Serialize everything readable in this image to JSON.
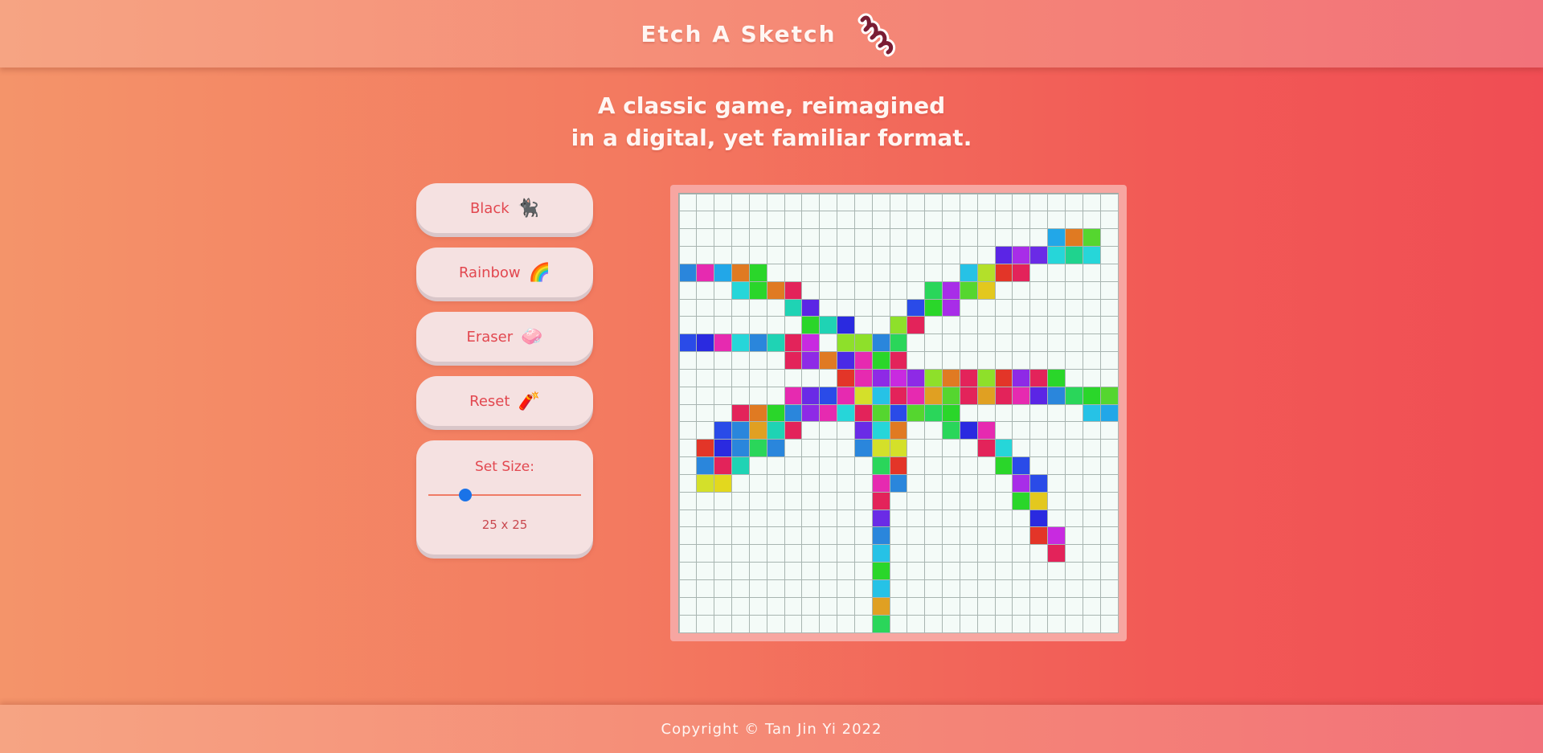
{
  "header": {
    "title": "Etch A Sketch",
    "logo_icon": "squiggle-logo-icon"
  },
  "tagline": {
    "line1": "A classic game, reimagined",
    "line2": "in a digital, yet familiar format."
  },
  "buttons": [
    {
      "label": "Black",
      "emoji": "🐈‍⬛",
      "icon": "black-cat-icon"
    },
    {
      "label": "Rainbow",
      "emoji": "🌈",
      "icon": "rainbow-icon"
    },
    {
      "label": "Eraser",
      "emoji": "🧼",
      "icon": "eraser-icon"
    },
    {
      "label": "Reset",
      "emoji": "🧨",
      "icon": "firecracker-icon"
    }
  ],
  "size": {
    "label": "Set Size:",
    "value_text": "25 x 25",
    "value": 25,
    "min": 1,
    "max": 100
  },
  "grid": {
    "size": 25,
    "empty_color": "#f4fbf8",
    "painted": [
      [
        2,
        21,
        "#22a7e8"
      ],
      [
        2,
        22,
        "#e07a22"
      ],
      [
        2,
        23,
        "#55d62f"
      ],
      [
        3,
        18,
        "#5b25e5"
      ],
      [
        3,
        19,
        "#a82de8"
      ],
      [
        3,
        20,
        "#6a2be6"
      ],
      [
        3,
        21,
        "#26d6d9"
      ],
      [
        3,
        22,
        "#1fd38e"
      ],
      [
        3,
        23,
        "#26d6d9"
      ],
      [
        4,
        0,
        "#2a86dc"
      ],
      [
        4,
        1,
        "#e62ab0"
      ],
      [
        4,
        2,
        "#22a7e8"
      ],
      [
        4,
        3,
        "#e07a22"
      ],
      [
        4,
        4,
        "#2ad62a"
      ],
      [
        4,
        16,
        "#26c2e6"
      ],
      [
        4,
        17,
        "#b3e02a"
      ],
      [
        4,
        18,
        "#e33528"
      ],
      [
        4,
        19,
        "#e3235a"
      ],
      [
        5,
        3,
        "#26d6d9"
      ],
      [
        5,
        4,
        "#2ad62a"
      ],
      [
        5,
        5,
        "#e07a22"
      ],
      [
        5,
        6,
        "#e3235a"
      ],
      [
        5,
        14,
        "#2ad65a"
      ],
      [
        5,
        15,
        "#a82de8"
      ],
      [
        5,
        16,
        "#55d62f"
      ],
      [
        5,
        17,
        "#e3c81e"
      ],
      [
        6,
        6,
        "#1fd3b4"
      ],
      [
        6,
        7,
        "#5b25e5"
      ],
      [
        6,
        13,
        "#2a4be8"
      ],
      [
        6,
        14,
        "#2ad62a"
      ],
      [
        6,
        15,
        "#a82de8"
      ],
      [
        7,
        7,
        "#2ad62a"
      ],
      [
        7,
        8,
        "#1fd3b4"
      ],
      [
        7,
        9,
        "#2a2ae0"
      ],
      [
        7,
        12,
        "#8ee02a"
      ],
      [
        7,
        13,
        "#e3235a"
      ],
      [
        8,
        0,
        "#2a4be8"
      ],
      [
        8,
        1,
        "#2a2ae0"
      ],
      [
        8,
        2,
        "#e62ab0"
      ],
      [
        8,
        3,
        "#26d6d9"
      ],
      [
        8,
        4,
        "#2a86dc"
      ],
      [
        8,
        5,
        "#1fd3b4"
      ],
      [
        8,
        6,
        "#e3235a"
      ],
      [
        8,
        7,
        "#c82ae0"
      ],
      [
        8,
        9,
        "#8ee02a"
      ],
      [
        8,
        10,
        "#8ee02a"
      ],
      [
        8,
        11,
        "#2a86dc"
      ],
      [
        8,
        12,
        "#2ad65a"
      ],
      [
        9,
        6,
        "#e3235a"
      ],
      [
        9,
        7,
        "#8e2ae6"
      ],
      [
        9,
        8,
        "#e07a22"
      ],
      [
        9,
        9,
        "#4a2ae6"
      ],
      [
        9,
        10,
        "#e62ab0"
      ],
      [
        9,
        11,
        "#2ad62a"
      ],
      [
        9,
        12,
        "#e3235a"
      ],
      [
        10,
        9,
        "#e33528"
      ],
      [
        10,
        10,
        "#e62ab0"
      ],
      [
        10,
        11,
        "#8e2ae6"
      ],
      [
        10,
        12,
        "#c82ae0"
      ],
      [
        10,
        13,
        "#8e2ae6"
      ],
      [
        10,
        14,
        "#8ee02a"
      ],
      [
        10,
        15,
        "#e07a22"
      ],
      [
        10,
        16,
        "#e3235a"
      ],
      [
        10,
        17,
        "#8ee02a"
      ],
      [
        10,
        18,
        "#e33528"
      ],
      [
        10,
        19,
        "#8e2ae6"
      ],
      [
        10,
        20,
        "#e3235a"
      ],
      [
        10,
        21,
        "#2ad62a"
      ],
      [
        11,
        6,
        "#e62ab0"
      ],
      [
        11,
        7,
        "#6a2be6"
      ],
      [
        11,
        8,
        "#2a4be8"
      ],
      [
        11,
        9,
        "#e62ab0"
      ],
      [
        11,
        10,
        "#d4e02a"
      ],
      [
        11,
        11,
        "#26c2e6"
      ],
      [
        11,
        12,
        "#e3235a"
      ],
      [
        11,
        13,
        "#e62ab0"
      ],
      [
        11,
        14,
        "#e0a022"
      ],
      [
        11,
        15,
        "#55d62f"
      ],
      [
        11,
        16,
        "#e3235a"
      ],
      [
        11,
        17,
        "#e0a022"
      ],
      [
        11,
        18,
        "#e3235a"
      ],
      [
        11,
        19,
        "#e62ab0"
      ],
      [
        11,
        20,
        "#5b25e5"
      ],
      [
        11,
        21,
        "#2a86dc"
      ],
      [
        11,
        22,
        "#2ad65a"
      ],
      [
        11,
        23,
        "#2ad62a"
      ],
      [
        11,
        24,
        "#55d62f"
      ],
      [
        12,
        3,
        "#e3235a"
      ],
      [
        12,
        4,
        "#e07a22"
      ],
      [
        12,
        5,
        "#2ad62a"
      ],
      [
        12,
        6,
        "#2a86dc"
      ],
      [
        12,
        7,
        "#8e2ae6"
      ],
      [
        12,
        8,
        "#e62ab0"
      ],
      [
        12,
        9,
        "#26d6d9"
      ],
      [
        12,
        10,
        "#e3235a"
      ],
      [
        12,
        11,
        "#55d62f"
      ],
      [
        12,
        12,
        "#2a4be8"
      ],
      [
        12,
        13,
        "#55d62f"
      ],
      [
        12,
        14,
        "#2ad65a"
      ],
      [
        12,
        15,
        "#2ad62a"
      ],
      [
        12,
        23,
        "#26c2e6"
      ],
      [
        12,
        24,
        "#22a7e8"
      ],
      [
        13,
        2,
        "#2a4be8"
      ],
      [
        13,
        3,
        "#2a86dc"
      ],
      [
        13,
        4,
        "#e0a022"
      ],
      [
        13,
        5,
        "#1fd3b4"
      ],
      [
        13,
        6,
        "#e3235a"
      ],
      [
        13,
        10,
        "#6a2be6"
      ],
      [
        13,
        11,
        "#26d6d9"
      ],
      [
        13,
        12,
        "#e07a22"
      ],
      [
        13,
        15,
        "#2ad65a"
      ],
      [
        13,
        16,
        "#2a2ae0"
      ],
      [
        13,
        17,
        "#e62ab0"
      ],
      [
        14,
        1,
        "#e33528"
      ],
      [
        14,
        2,
        "#2a2ae0"
      ],
      [
        14,
        3,
        "#2a86dc"
      ],
      [
        14,
        4,
        "#2ad65a"
      ],
      [
        14,
        5,
        "#2a86dc"
      ],
      [
        14,
        10,
        "#2a86dc"
      ],
      [
        14,
        11,
        "#d4e02a"
      ],
      [
        14,
        12,
        "#d4e02a"
      ],
      [
        14,
        17,
        "#e3235a"
      ],
      [
        14,
        18,
        "#26d6d9"
      ],
      [
        15,
        1,
        "#2a86dc"
      ],
      [
        15,
        2,
        "#e3235a"
      ],
      [
        15,
        3,
        "#1fd3b4"
      ],
      [
        15,
        11,
        "#2ad65a"
      ],
      [
        15,
        12,
        "#e33528"
      ],
      [
        15,
        18,
        "#2ad62a"
      ],
      [
        15,
        19,
        "#2a4be8"
      ],
      [
        16,
        1,
        "#d4e02a"
      ],
      [
        16,
        2,
        "#e3d81e"
      ],
      [
        16,
        11,
        "#e62ab0"
      ],
      [
        16,
        12,
        "#2a86dc"
      ],
      [
        16,
        19,
        "#a82de8"
      ],
      [
        16,
        20,
        "#2a4be8"
      ],
      [
        17,
        11,
        "#e3235a"
      ],
      [
        17,
        19,
        "#2ad62a"
      ],
      [
        17,
        20,
        "#e3c81e"
      ],
      [
        18,
        11,
        "#6a2be6"
      ],
      [
        18,
        20,
        "#2a2ae0"
      ],
      [
        19,
        11,
        "#2a86dc"
      ],
      [
        19,
        20,
        "#e33528"
      ],
      [
        19,
        21,
        "#c82ae0"
      ],
      [
        20,
        11,
        "#26c2e6"
      ],
      [
        20,
        21,
        "#e3235a"
      ],
      [
        21,
        11,
        "#2ad62a"
      ],
      [
        22,
        11,
        "#26c2e6"
      ],
      [
        23,
        11,
        "#e0a022"
      ],
      [
        24,
        11,
        "#2ad65a"
      ]
    ]
  },
  "footer": {
    "text": "Copyright © Tan Jin Yi 2022"
  }
}
